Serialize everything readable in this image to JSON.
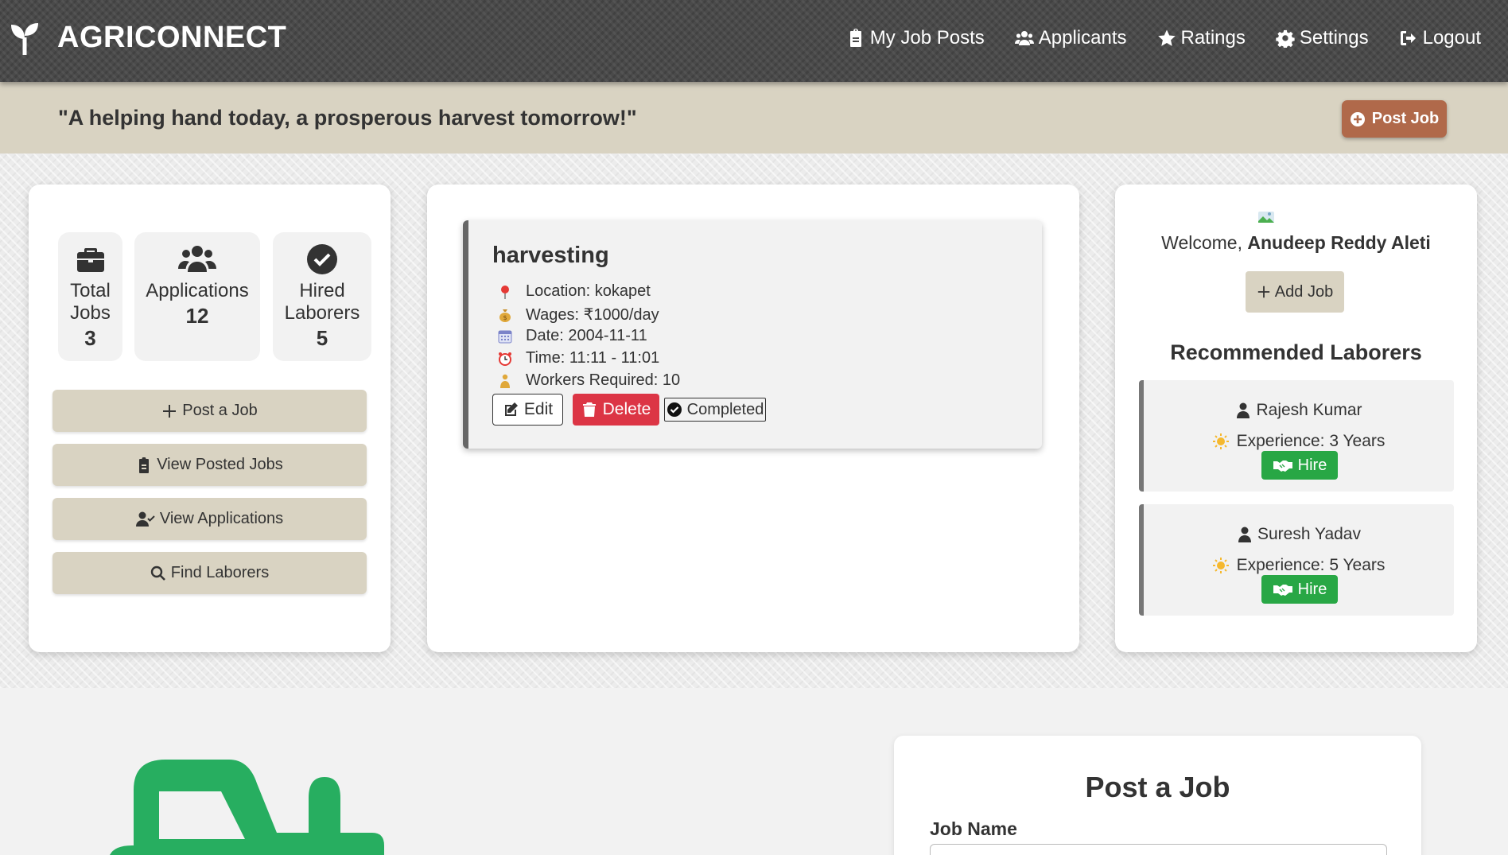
{
  "header": {
    "brand": "AGRICONNECT",
    "nav": [
      {
        "label": "My Job Posts",
        "icon": "clipboard-icon"
      },
      {
        "label": "Applicants",
        "icon": "users-icon"
      },
      {
        "label": "Ratings",
        "icon": "star-icon"
      },
      {
        "label": "Settings",
        "icon": "gear-icon"
      },
      {
        "label": "Logout",
        "icon": "logout-icon"
      }
    ]
  },
  "banner": {
    "quote": "\"A helping hand today, a prosperous harvest tomorrow!\"",
    "post_job": "Post Job"
  },
  "stats": [
    {
      "label": "Total Jobs",
      "value": "3",
      "icon": "briefcase-icon"
    },
    {
      "label": "Applications",
      "value": "12",
      "icon": "users-icon"
    },
    {
      "label": "Hired Laborers",
      "value": "5",
      "icon": "check-circle-icon"
    }
  ],
  "sidebar": {
    "buttons": [
      {
        "label": "Post a Job",
        "icon": "plus-icon"
      },
      {
        "label": "View Posted Jobs",
        "icon": "clipboard-icon"
      },
      {
        "label": "View Applications",
        "icon": "user-check-icon"
      },
      {
        "label": "Find Laborers",
        "icon": "search-icon"
      }
    ]
  },
  "job": {
    "title": "harvesting",
    "location": "Location: kokapet",
    "wages": "Wages: ₹1000/day",
    "date": "Date: 2004-11-11",
    "time": "Time: 11:11 - 11:01",
    "workers": "Workers Required: 10",
    "edit": "Edit",
    "delete": "Delete",
    "completed": "Completed"
  },
  "profile": {
    "welcome_prefix": "Welcome, ",
    "name": "Anudeep Reddy Aleti",
    "add_job": "Add Job"
  },
  "recommended": {
    "title": "Recommended Laborers",
    "laborers": [
      {
        "name": "Rajesh Kumar",
        "experience": "Experience: 3 Years",
        "hire": "Hire"
      },
      {
        "name": "Suresh Yadav",
        "experience": "Experience: 5 Years",
        "hire": "Hire"
      }
    ]
  },
  "post_form": {
    "title": "Post a Job",
    "job_name_label": "Job Name"
  },
  "colors": {
    "header": "#4a4a4a",
    "banner": "#d9d3c2",
    "accent_brown": "#b0694a",
    "delete": "#dc3545",
    "hire": "#28a745",
    "tractor": "#27ae60"
  }
}
